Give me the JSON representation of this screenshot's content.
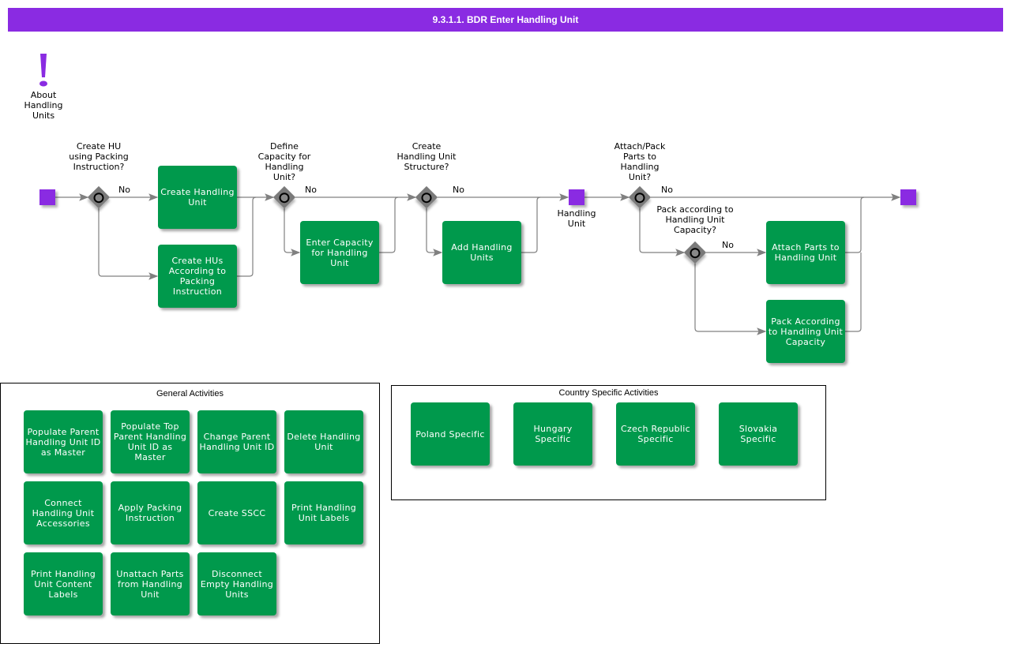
{
  "title": "9.3.1.1. BDR Enter Handling Unit",
  "colors": {
    "accent": "#8a2be2",
    "activity": "#00994c",
    "gateway": "#7a7a7a",
    "connector": "#808080"
  },
  "about": {
    "icon": "exclamation-icon",
    "label": "About Handling Units"
  },
  "flow": {
    "gateways": [
      {
        "id": "g1",
        "question": "Create HU using Packing Instruction?",
        "no_label": "No"
      },
      {
        "id": "g2",
        "question": "Define Capacity for Handling Unit?",
        "no_label": "No"
      },
      {
        "id": "g3",
        "question": "Create Handling Unit Structure?",
        "no_label": "No"
      },
      {
        "id": "g4",
        "question": "Attach/Pack Parts to Handling Unit?",
        "no_label": "No"
      },
      {
        "id": "g5",
        "question": "Pack according to Handling Unit Capacity?",
        "no_label": "No"
      }
    ],
    "activities": [
      {
        "id": "a1",
        "label": "Create Handling Unit"
      },
      {
        "id": "a2",
        "label": "Create HUs According to Packing Instruction"
      },
      {
        "id": "a3",
        "label": "Enter Capacity for Handling Unit"
      },
      {
        "id": "a4",
        "label": "Add Handling Units"
      },
      {
        "id": "a5",
        "label": "Attach Parts to Handling Unit"
      },
      {
        "id": "a6",
        "label": "Pack According to Handling Unit Capacity"
      }
    ],
    "events": [
      {
        "id": "start",
        "label": ""
      },
      {
        "id": "intermediate",
        "label": "Handling Unit"
      },
      {
        "id": "end",
        "label": ""
      }
    ]
  },
  "general_activities": {
    "title": "General Activities",
    "items": [
      "Populate Parent Handling Unit ID as Master",
      "Populate Top Parent Handling Unit ID as Master",
      "Change Parent Handling Unit ID",
      "Delete Handling Unit",
      "Connect Handling Unit Accessories",
      "Apply Packing Instruction",
      "Create SSCC",
      "Print Handling Unit Labels",
      "Print Handling Unit Content Labels",
      "Unattach Parts from Handling Unit",
      "Disconnect Empty Handling Units"
    ]
  },
  "country_activities": {
    "title": "Country Specific Activities",
    "items": [
      "Poland Specific",
      "Hungary Specific",
      "Czech Republic Specific",
      "Slovakia Specific"
    ]
  }
}
